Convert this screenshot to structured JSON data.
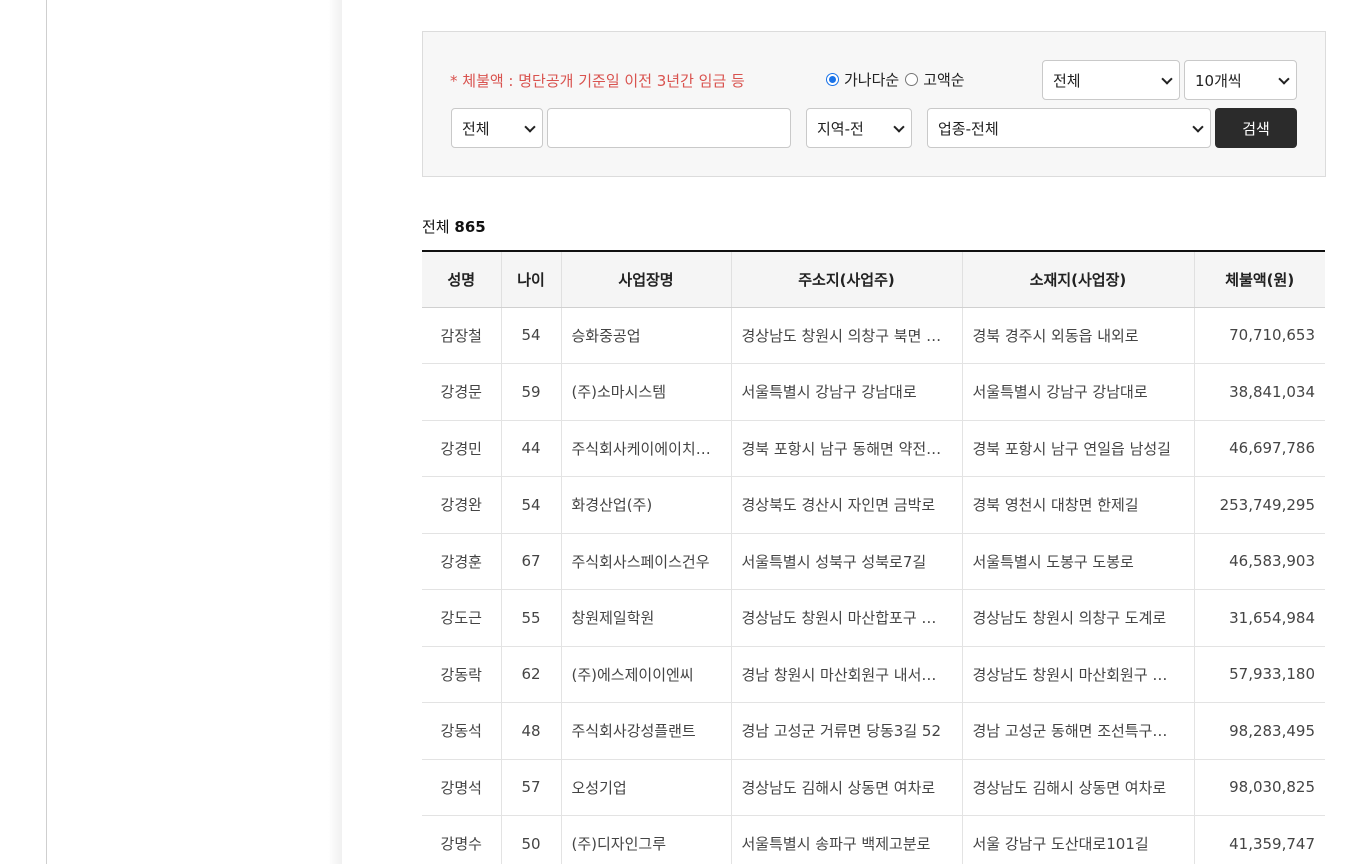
{
  "filters": {
    "notice": "* 체불액 : 명단공개 기준일 이전 3년간 임금 등",
    "sort_options": [
      {
        "label": "가나다순",
        "checked": true
      },
      {
        "label": "고액순",
        "checked": false
      }
    ],
    "category_select": "전체",
    "page_size_select": "10개씩",
    "field_select": "전체",
    "search_value": "",
    "region_select": "지역-전",
    "industry_select": "업종-전체",
    "search_button": "검색"
  },
  "summary": {
    "total_label": "전체",
    "total_count": "865"
  },
  "table": {
    "headers": [
      "성명",
      "나이",
      "사업장명",
      "주소지(사업주)",
      "소재지(사업장)",
      "체불액(원)"
    ],
    "rows": [
      [
        "감장철",
        "54",
        "승화중공업",
        "경상남도 창원시 의창구 북면 …",
        "경북 경주시 외동읍 내외로",
        "70,710,653"
      ],
      [
        "강경문",
        "59",
        "(주)소마시스템",
        "서울특별시 강남구 강남대로",
        "서울특별시 강남구 강남대로",
        "38,841,034"
      ],
      [
        "강경민",
        "44",
        "주식회사케이에이치…",
        "경북 포항시 남구 동해면 약전…",
        "경북 포항시 남구 연일읍 남성길",
        "46,697,786"
      ],
      [
        "강경완",
        "54",
        "화경산업(주)",
        "경상북도 경산시 자인면 금박로",
        "경북 영천시 대창면 한제길",
        "253,749,295"
      ],
      [
        "강경훈",
        "67",
        "주식회사스페이스건우",
        "서울특별시 성북구 성북로7길",
        "서울특별시 도봉구 도봉로",
        "46,583,903"
      ],
      [
        "강도근",
        "55",
        "창원제일학원",
        "경상남도 창원시 마산합포구 …",
        "경상남도 창원시 의창구 도계로",
        "31,654,984"
      ],
      [
        "강동락",
        "62",
        "(주)에스제이이엔씨",
        "경남 창원시 마산회원구 내서…",
        "경상남도 창원시 마산회원구 …",
        "57,933,180"
      ],
      [
        "강동석",
        "48",
        "주식회사강성플랜트",
        "경남 고성군 거류면 당동3길 52",
        "경남 고성군 동해면 조선특구…",
        "98,283,495"
      ],
      [
        "강명석",
        "57",
        "오성기업",
        "경상남도 김해시 상동면 여차로",
        "경상남도 김해시 상동면 여차로",
        "98,030,825"
      ],
      [
        "강명수",
        "50",
        "(주)디자인그루",
        "서울특별시 송파구 백제고분로",
        "서울 강남구 도산대로101길",
        "41,359,747"
      ]
    ]
  }
}
